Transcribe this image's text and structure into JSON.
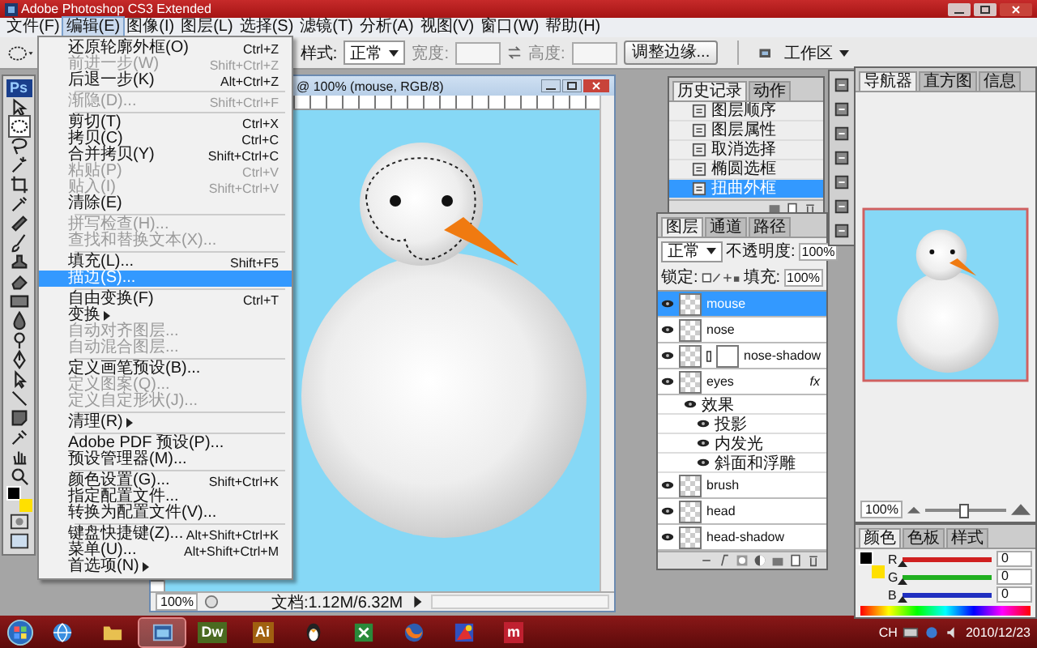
{
  "window": {
    "title": "Adobe Photoshop CS3 Extended"
  },
  "menu_bar": [
    {
      "label": "文件(F)",
      "selected": false
    },
    {
      "label": "编辑(E)",
      "selected": true
    },
    {
      "label": "图像(I)",
      "selected": false
    },
    {
      "label": "图层(L)",
      "selected": false
    },
    {
      "label": "选择(S)",
      "selected": false
    },
    {
      "label": "滤镜(T)",
      "selected": false
    },
    {
      "label": "分析(A)",
      "selected": false
    },
    {
      "label": "视图(V)",
      "selected": false
    },
    {
      "label": "窗口(W)",
      "selected": false
    },
    {
      "label": "帮助(H)",
      "selected": false
    }
  ],
  "options_bar": {
    "style_label": "样式:",
    "style_value": "正常",
    "width_label": "宽度:",
    "height_label": "高度:",
    "refine_button": "调整边缘...",
    "workspace": "工作区"
  },
  "toolbox": {
    "logo": "Ps"
  },
  "document": {
    "title": "@ 100% (mouse, RGB/8)",
    "zoom": "100%",
    "doc_info": "文档:1.12M/6.32M"
  },
  "edit_menu": [
    {
      "kind": "item",
      "label": "还原轮廓外框(O)",
      "shortcut": "Ctrl+Z",
      "disabled": false,
      "selected": false,
      "submenu": false
    },
    {
      "kind": "item",
      "label": "前进一步(W)",
      "shortcut": "Shift+Ctrl+Z",
      "disabled": true,
      "selected": false,
      "submenu": false
    },
    {
      "kind": "item",
      "label": "后退一步(K)",
      "shortcut": "Alt+Ctrl+Z",
      "disabled": false,
      "selected": false,
      "submenu": false
    },
    {
      "kind": "separator"
    },
    {
      "kind": "item",
      "label": "渐隐(D)...",
      "shortcut": "Shift+Ctrl+F",
      "disabled": true,
      "selected": false,
      "submenu": false
    },
    {
      "kind": "separator"
    },
    {
      "kind": "item",
      "label": "剪切(T)",
      "shortcut": "Ctrl+X",
      "disabled": false,
      "selected": false,
      "submenu": false
    },
    {
      "kind": "item",
      "label": "拷贝(C)",
      "shortcut": "Ctrl+C",
      "disabled": false,
      "selected": false,
      "submenu": false
    },
    {
      "kind": "item",
      "label": "合并拷贝(Y)",
      "shortcut": "Shift+Ctrl+C",
      "disabled": false,
      "selected": false,
      "submenu": false
    },
    {
      "kind": "item",
      "label": "粘贴(P)",
      "shortcut": "Ctrl+V",
      "disabled": true,
      "selected": false,
      "submenu": false
    },
    {
      "kind": "item",
      "label": "贴入(I)",
      "shortcut": "Shift+Ctrl+V",
      "disabled": true,
      "selected": false,
      "submenu": false
    },
    {
      "kind": "item",
      "label": "清除(E)",
      "disabled": false,
      "selected": false,
      "submenu": false
    },
    {
      "kind": "separator"
    },
    {
      "kind": "item",
      "label": "拼写检查(H)...",
      "disabled": true,
      "selected": false,
      "submenu": false
    },
    {
      "kind": "item",
      "label": "查找和替换文本(X)...",
      "disabled": true,
      "selected": false,
      "submenu": false
    },
    {
      "kind": "separator"
    },
    {
      "kind": "item",
      "label": "填充(L)...",
      "shortcut": "Shift+F5",
      "disabled": false,
      "selected": false,
      "submenu": false
    },
    {
      "kind": "item",
      "label": "描边(S)...",
      "disabled": false,
      "selected": true,
      "submenu": false
    },
    {
      "kind": "separator"
    },
    {
      "kind": "item",
      "label": "自由变换(F)",
      "shortcut": "Ctrl+T",
      "disabled": false,
      "selected": false,
      "submenu": false
    },
    {
      "kind": "item",
      "label": "变换",
      "disabled": false,
      "selected": false,
      "submenu": true
    },
    {
      "kind": "item",
      "label": "自动对齐图层...",
      "disabled": true,
      "selected": false,
      "submenu": false
    },
    {
      "kind": "item",
      "label": "自动混合图层...",
      "disabled": true,
      "selected": false,
      "submenu": false
    },
    {
      "kind": "separator"
    },
    {
      "kind": "item",
      "label": "定义画笔预设(B)...",
      "disabled": false,
      "selected": false,
      "submenu": false
    },
    {
      "kind": "item",
      "label": "定义图案(Q)...",
      "disabled": true,
      "selected": false,
      "submenu": false
    },
    {
      "kind": "item",
      "label": "定义自定形状(J)...",
      "disabled": true,
      "selected": false,
      "submenu": false
    },
    {
      "kind": "separator"
    },
    {
      "kind": "item",
      "label": "清理(R)",
      "disabled": false,
      "selected": false,
      "submenu": true
    },
    {
      "kind": "separator"
    },
    {
      "kind": "item",
      "label": "Adobe PDF 预设(P)...",
      "disabled": false,
      "selected": false,
      "submenu": false
    },
    {
      "kind": "item",
      "label": "预设管理器(M)...",
      "disabled": false,
      "selected": false,
      "submenu": false
    },
    {
      "kind": "separator"
    },
    {
      "kind": "item",
      "label": "颜色设置(G)...",
      "shortcut": "Shift+Ctrl+K",
      "disabled": false,
      "selected": false,
      "submenu": false
    },
    {
      "kind": "item",
      "label": "指定配置文件...",
      "disabled": false,
      "selected": false,
      "submenu": false
    },
    {
      "kind": "item",
      "label": "转换为配置文件(V)...",
      "disabled": false,
      "selected": false,
      "submenu": false
    },
    {
      "kind": "separator"
    },
    {
      "kind": "item",
      "label": "键盘快捷键(Z)...",
      "shortcut": "Alt+Shift+Ctrl+K",
      "disabled": false,
      "selected": false,
      "submenu": false
    },
    {
      "kind": "item",
      "label": "菜单(U)...",
      "shortcut": "Alt+Shift+Ctrl+M",
      "disabled": false,
      "selected": false,
      "submenu": false
    },
    {
      "kind": "item",
      "label": "首选项(N)",
      "disabled": false,
      "selected": false,
      "submenu": true
    }
  ],
  "history": {
    "tabs": [
      {
        "label": "历史记录",
        "selected": true
      },
      {
        "label": "动作",
        "selected": false
      }
    ],
    "items": [
      {
        "label": "图层顺序",
        "selected": false
      },
      {
        "label": "图层属性",
        "selected": false
      },
      {
        "label": "取消选择",
        "selected": false
      },
      {
        "label": "椭圆选框",
        "selected": false
      },
      {
        "label": "扭曲外框",
        "selected": true
      }
    ]
  },
  "layers": {
    "tabs": [
      {
        "label": "图层",
        "selected": true
      },
      {
        "label": "通道",
        "selected": false
      },
      {
        "label": "路径",
        "selected": false
      }
    ],
    "blend_mode": "正常",
    "opacity_label": "不透明度:",
    "opacity": "100%",
    "lock_label": "锁定:",
    "fill_label": "填充:",
    "fill": "100%",
    "items": [
      {
        "name": "mouse",
        "selected": true,
        "visible": true,
        "mask": false
      },
      {
        "name": "nose",
        "selected": false,
        "visible": true,
        "mask": false
      },
      {
        "name": "nose-shadow",
        "selected": false,
        "visible": true,
        "mask": true
      },
      {
        "name": "eyes",
        "selected": false,
        "visible": true,
        "mask": false,
        "fx": "fx",
        "effects_label": "效果",
        "effects": [
          {
            "name": "投影",
            "visible": true
          },
          {
            "name": "内发光",
            "visible": true
          },
          {
            "name": "斜面和浮雕",
            "visible": true
          }
        ]
      },
      {
        "name": "brush",
        "selected": false,
        "visible": true,
        "mask": false
      },
      {
        "name": "head",
        "selected": false,
        "visible": true,
        "mask": false
      },
      {
        "name": "head-shadow",
        "selected": false,
        "visible": true,
        "mask": false
      }
    ]
  },
  "navigator": {
    "tabs": [
      {
        "label": "导航器",
        "selected": true
      },
      {
        "label": "直方图",
        "selected": false
      },
      {
        "label": "信息",
        "selected": false
      }
    ],
    "zoom": "100%",
    "level": 0.45
  },
  "color": {
    "tabs": [
      {
        "label": "颜色",
        "selected": true
      },
      {
        "label": "色板",
        "selected": false
      },
      {
        "label": "样式",
        "selected": false
      }
    ],
    "channels": [
      {
        "label": "R",
        "value": "0",
        "level": 0,
        "color": "#d02020"
      },
      {
        "label": "G",
        "value": "0",
        "level": 0,
        "color": "#20b020"
      },
      {
        "label": "B",
        "value": "0",
        "level": 0,
        "color": "#2030c0"
      }
    ]
  },
  "taskbar": {
    "apps": [
      {
        "kind": "globe",
        "selected": false
      },
      {
        "kind": "folder",
        "selected": false
      },
      {
        "kind": "window",
        "selected": true
      },
      {
        "kind": "text",
        "label": "Dw",
        "color": "#4a6a20",
        "selected": false
      },
      {
        "kind": "text",
        "label": "Ai",
        "color": "#a06010",
        "selected": false
      },
      {
        "kind": "penguin",
        "selected": false
      },
      {
        "kind": "sheet",
        "selected": false
      },
      {
        "kind": "fox",
        "selected": false
      },
      {
        "kind": "paint",
        "selected": false
      },
      {
        "kind": "text",
        "label": "m",
        "color": "#c02030",
        "selected": false
      }
    ],
    "lang": "CH",
    "date": "2010/12/23"
  }
}
